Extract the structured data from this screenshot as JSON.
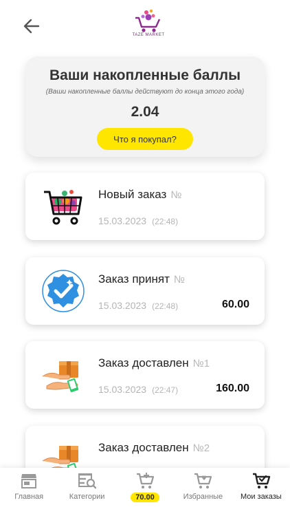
{
  "app": {
    "logo_text": "TAZE MARKET"
  },
  "points": {
    "title": "Ваши накопленные баллы",
    "subtitle": "(Ваши накопленные баллы действуют до конца этого года)",
    "value": "2.04",
    "button_label": "Что я покупал?"
  },
  "orders": [
    {
      "title": "Новый заказ",
      "number": "№",
      "date": "15.03.2023",
      "time": "(22:48)",
      "amount": "",
      "icon": "shopping-cart-icon"
    },
    {
      "title": "Заказ принят",
      "number": "№",
      "date": "15.03.2023",
      "time": "(22:48)",
      "amount": "60.00",
      "icon": "verified-badge-icon"
    },
    {
      "title": "Заказ доставлен",
      "number": "№1",
      "date": "15.03.2023",
      "time": "(22:47)",
      "amount": "160.00",
      "icon": "delivery-box-icon"
    },
    {
      "title": "Заказ доставлен",
      "number": "№2",
      "date": "",
      "time": "",
      "amount": "",
      "icon": "delivery-box-icon"
    }
  ],
  "nav": {
    "home": "Главная",
    "categories": "Категории",
    "cart_total": "70.00",
    "favorites": "Избранные",
    "my_orders": "Мои заказы"
  },
  "colors": {
    "accent": "#ffe600",
    "check_blue": "#2f8fe0"
  }
}
